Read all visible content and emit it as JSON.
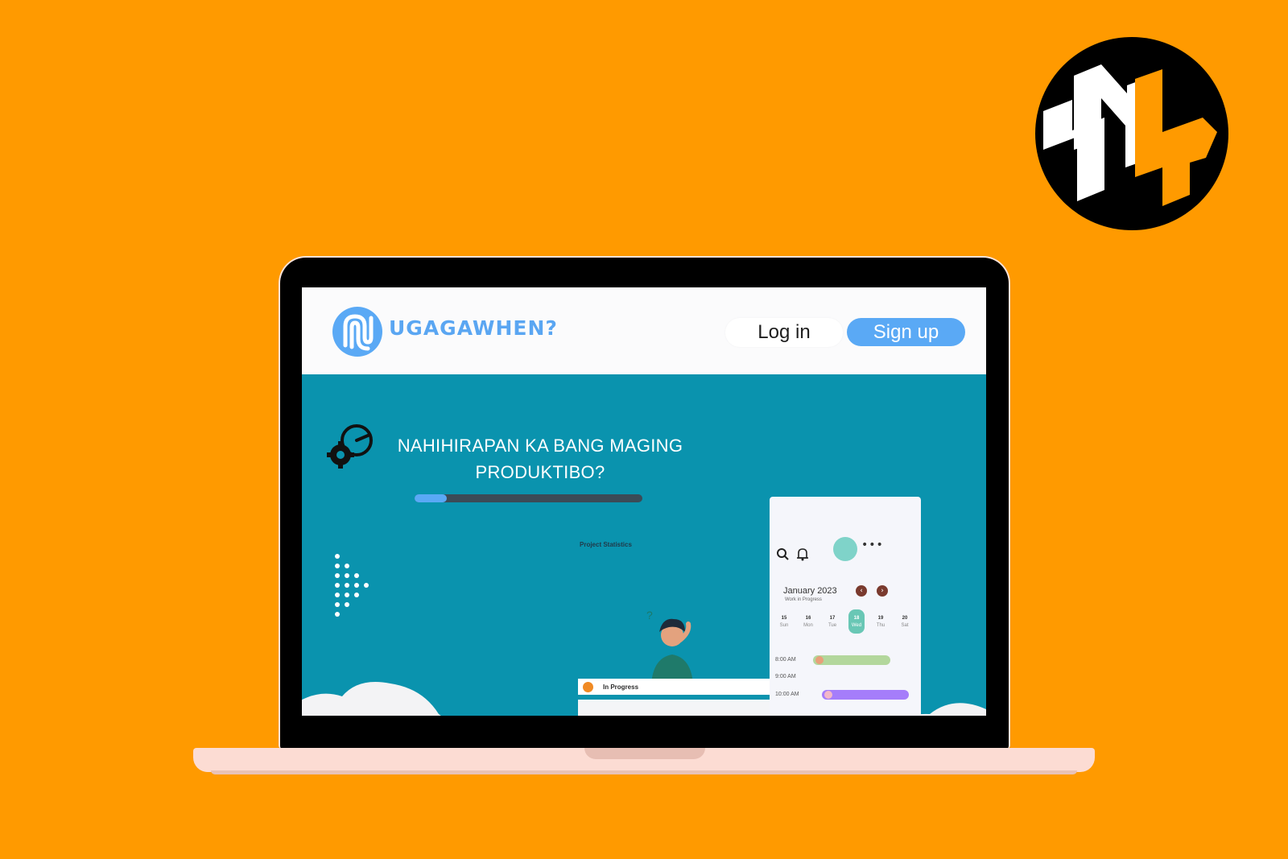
{
  "site": {
    "name": "UGAGAWHEN?",
    "login_label": "Log in",
    "signup_label": "Sign up"
  },
  "hero": {
    "title_line1": "NAHIHIRAPAN KA BANG MAGING",
    "title_line2": "PRODUKTIBO?",
    "progress": 0.14,
    "project_stats_label": "Project Statistics"
  },
  "progress_card": {
    "label": "In Progress"
  },
  "calendar": {
    "month": "January 2023",
    "subtitle": "Work in Progress",
    "days": [
      {
        "num": "15",
        "name": "Sun"
      },
      {
        "num": "16",
        "name": "Mon"
      },
      {
        "num": "17",
        "name": "Tue"
      },
      {
        "num": "18",
        "name": "Wed",
        "active": true
      },
      {
        "num": "19",
        "name": "Thu"
      },
      {
        "num": "20",
        "name": "Sat"
      }
    ],
    "times": [
      "8:00 AM",
      "9:00 AM",
      "10:00 AM"
    ],
    "more_label": "•••"
  },
  "icons": {
    "brand_badge": "brand-logo",
    "site_logo": "logo-icon",
    "hero_gear": "gear-clock-icon",
    "search": "search-icon",
    "bell": "bell-icon",
    "prev": "chevron-left-icon",
    "next": "chevron-right-icon"
  },
  "colors": {
    "background": "#FF9A00",
    "hero": "#0A93AE",
    "accent_blue": "#5AA9F5"
  }
}
